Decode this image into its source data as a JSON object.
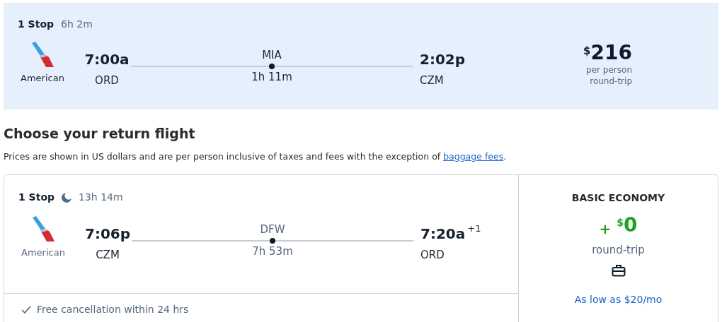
{
  "selected_flight": {
    "stops": "1 Stop",
    "duration": "6h 2m",
    "airline": "American",
    "depart_time": "7:00a",
    "depart_airport": "ORD",
    "layover_airport": "MIA",
    "layover_duration": "1h 11m",
    "arrive_time": "2:02p",
    "arrive_airport": "CZM",
    "currency": "$",
    "price": "216",
    "price_note_1": "per person",
    "price_note_2": "round-trip"
  },
  "heading": "Choose your return flight",
  "notice": {
    "text": "Prices are shown in US dollars and are per person inclusive of taxes and fees with the exception of ",
    "link": "baggage fees",
    "end": "."
  },
  "return_flight": {
    "stops": "1 Stop",
    "overnight": true,
    "duration": "13h 14m",
    "airline": "American",
    "depart_time": "7:06p",
    "depart_airport": "CZM",
    "layover_airport": "DFW",
    "layover_duration": "7h 53m",
    "arrive_time": "7:20a",
    "day_offset": "+1",
    "arrive_airport": "ORD",
    "cancellation": "Free cancellation within 24 hrs",
    "fare": {
      "name": "BASIC ECONOMY",
      "plus": "+",
      "currency": "$",
      "price": "0",
      "note": "round-trip",
      "financing": "As low as $20/mo"
    }
  }
}
